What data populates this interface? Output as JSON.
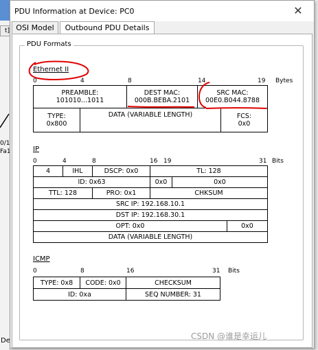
{
  "window": {
    "title": "PDU Information at Device: PC0",
    "close_glyph": "✕",
    "tabs": [
      {
        "label": "OSI Model"
      },
      {
        "label": "Outbound PDU Details"
      }
    ]
  },
  "background_fragments": {
    "left_button": "t]",
    "left_labels": [
      "0/1",
      "Fa1"
    ],
    "bottom_left": "De"
  },
  "pdu_formats": {
    "legend": "PDU Formats",
    "ethernet": {
      "title": "Ethernet II",
      "ticks": [
        "0",
        "4",
        "8",
        "14",
        "19"
      ],
      "units": "Bytes",
      "preamble_label": "PREAMBLE:",
      "preamble_value": "101010...1011",
      "dest_mac_label": "DEST MAC:",
      "dest_mac_value": "000B.BEBA.2101",
      "src_mac_label": "SRC MAC:",
      "src_mac_value": "00E0.B044.8788",
      "type_label": "TYPE:",
      "type_value": "0x800",
      "data_label": "DATA (VARIABLE LENGTH)",
      "fcs_label": "FCS:",
      "fcs_value": "0x0"
    },
    "ip": {
      "title": "IP",
      "ticks": [
        "0",
        "4",
        "8",
        "16",
        "19",
        "31"
      ],
      "units": "Bits",
      "version": "4",
      "ihl": "IHL",
      "dscp": "DSCP: 0x0",
      "tl": "TL: 128",
      "id": "ID: 0x63",
      "flags": "0x0",
      "frag_offset": "0x0",
      "ttl": "TTL: 128",
      "pro": "PRO: 0x1",
      "chksum": "CHKSUM",
      "src_ip": "SRC IP: 192.168.10.1",
      "dst_ip": "DST IP: 192.168.30.1",
      "opt": "OPT: 0x0",
      "padding": "0x0",
      "data": "DATA (VARIABLE LENGTH)"
    },
    "icmp": {
      "title": "ICMP",
      "ticks": [
        "0",
        "8",
        "16",
        "31"
      ],
      "units": "Bits",
      "type": "TYPE: 0x8",
      "code": "CODE: 0x0",
      "checksum": "CHECKSUM",
      "id": "ID: 0xa",
      "seq": "SEQ NUMBER: 31"
    }
  },
  "watermark": "CSDN @谁是幸运儿",
  "colors": {
    "annotation_red": "#e00000"
  }
}
